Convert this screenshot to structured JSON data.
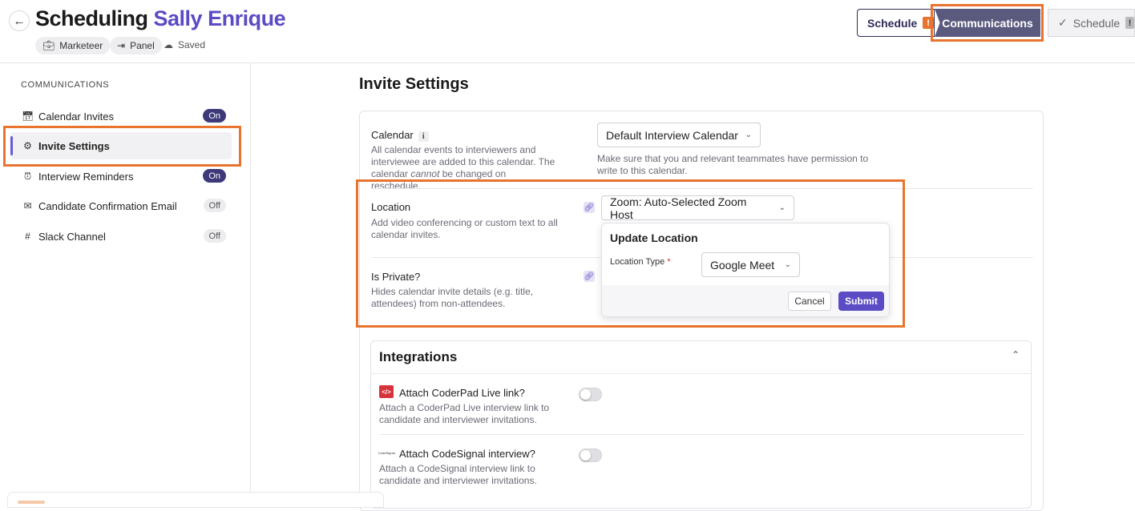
{
  "header": {
    "title_prefix": "Scheduling",
    "candidate_name": "Sally Enrique",
    "chips": [
      "Marketeer",
      "Panel"
    ],
    "saved_label": "Saved",
    "tabs": [
      {
        "label": "Schedule",
        "badge": "!"
      },
      {
        "label": "Communications"
      },
      {
        "label": "Schedule",
        "badge": "!"
      }
    ]
  },
  "sidebar": {
    "heading": "COMMUNICATIONS",
    "items": [
      {
        "label": "Calendar Invites",
        "status": "On"
      },
      {
        "label": "Invite Settings"
      },
      {
        "label": "Interview Reminders",
        "status": "On"
      },
      {
        "label": "Candidate Confirmation Email",
        "status": "Off"
      },
      {
        "label": "Slack Channel",
        "status": "Off"
      }
    ]
  },
  "main": {
    "title": "Invite Settings",
    "calendar": {
      "label": "Calendar",
      "description_1": "All calendar events to interviewers and interviewee are added to this calendar. The calendar ",
      "description_em": "cannot",
      "description_2": " be changed on reschedule.",
      "select_value": "Default Interview Calendar",
      "help": "Make sure that you and relevant teammates have permission to write to this calendar."
    },
    "location": {
      "label": "Location",
      "description": "Add video conferencing or custom text to all calendar invites.",
      "select_value": "Zoom: Auto-Selected Zoom Host"
    },
    "private": {
      "label": "Is Private?",
      "description": "Hides calendar invite details (e.g. title, attendees) from non-attendees."
    },
    "popover": {
      "title": "Update Location",
      "field_label": "Location Type",
      "required_mark": "*",
      "select_value": "Google Meet",
      "cancel_label": "Cancel",
      "submit_label": "Submit"
    },
    "integrations": {
      "title": "Integrations",
      "items": [
        {
          "label": "Attach CoderPad Live link?",
          "description": "Attach a CoderPad Live interview link to candidate and interviewer invitations.",
          "icon_text": "</>"
        },
        {
          "label": "Attach CodeSignal interview?",
          "description": "Attach a CodeSignal interview link to candidate and interviewer invitations.",
          "icon_text": "CodeSignal"
        }
      ]
    }
  },
  "colors": {
    "accent": "#5b4bc4",
    "highlight": "#e8742f",
    "on_pill": "#3e3a7a"
  }
}
